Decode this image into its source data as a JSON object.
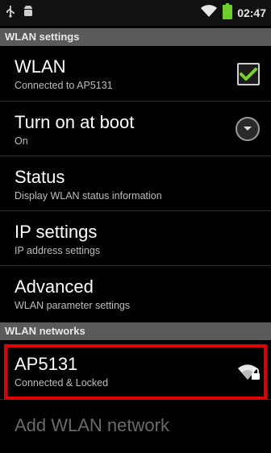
{
  "status_bar": {
    "time": "02:47",
    "icons": [
      "usb-icon",
      "android-debug-icon",
      "wifi-icon",
      "battery-icon"
    ],
    "battery_color": "#6bd12a"
  },
  "sections": {
    "settings_header": "WLAN settings",
    "networks_header": "WLAN networks"
  },
  "settings": {
    "wlan": {
      "title": "WLAN",
      "subtitle": "Connected to AP5131",
      "checked": true
    },
    "boot": {
      "title": "Turn on at boot",
      "subtitle": "On"
    },
    "status": {
      "title": "Status",
      "subtitle": "Display WLAN status information"
    },
    "ip": {
      "title": "IP settings",
      "subtitle": "IP address settings"
    },
    "advanced": {
      "title": "Advanced",
      "subtitle": "WLAN parameter settings"
    }
  },
  "networks": [
    {
      "ssid": "AP5131",
      "state": "Connected & Locked",
      "icon": "wifi-locked-icon"
    }
  ],
  "add_network": "Add WLAN network",
  "colors": {
    "highlight": "#e00000",
    "check": "#7ad321",
    "header_bg": "#5a5a5a"
  }
}
